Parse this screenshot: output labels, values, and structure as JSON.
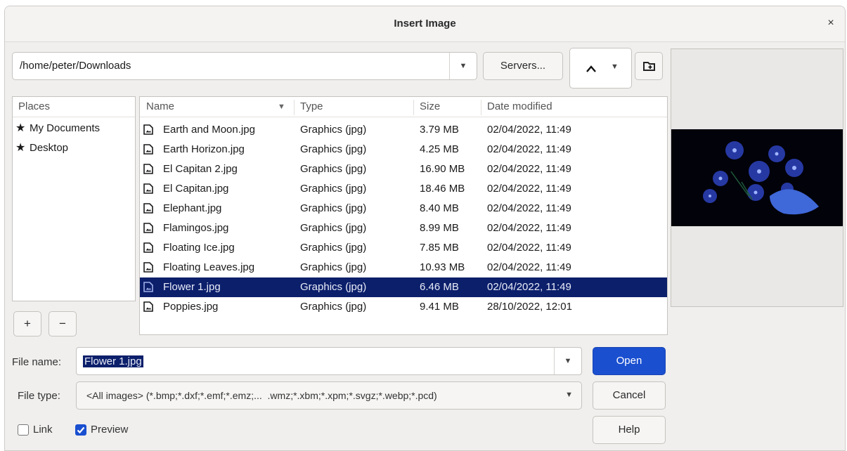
{
  "dialog": {
    "title": "Insert Image",
    "close_icon": "×"
  },
  "path": {
    "value": "/home/peter/Downloads",
    "dropdown_icon": "chevron-down-icon"
  },
  "toolbar": {
    "servers_label": "Servers...",
    "up_icon": "^",
    "up_dropdown_icon": "▾",
    "new_folder_icon": "new-folder-icon"
  },
  "places": {
    "header": "Places",
    "items": [
      {
        "label": "My Documents",
        "icon": "star-icon"
      },
      {
        "label": "Desktop",
        "icon": "star-icon"
      }
    ],
    "add_label": "+",
    "remove_label": "−"
  },
  "files": {
    "columns": {
      "name": "Name",
      "type": "Type",
      "size": "Size",
      "date": "Date modified"
    },
    "sort_icon": "▾",
    "rows": [
      {
        "name": "Earth and Moon.jpg",
        "type": "Graphics (jpg)",
        "size": "3.79 MB",
        "date": "02/04/2022, 11:49",
        "selected": false
      },
      {
        "name": "Earth Horizon.jpg",
        "type": "Graphics (jpg)",
        "size": "4.25 MB",
        "date": "02/04/2022, 11:49",
        "selected": false
      },
      {
        "name": "El Capitan 2.jpg",
        "type": "Graphics (jpg)",
        "size": "16.90 MB",
        "date": "02/04/2022, 11:49",
        "selected": false
      },
      {
        "name": "El Capitan.jpg",
        "type": "Graphics (jpg)",
        "size": "18.46 MB",
        "date": "02/04/2022, 11:49",
        "selected": false
      },
      {
        "name": "Elephant.jpg",
        "type": "Graphics (jpg)",
        "size": "8.40 MB",
        "date": "02/04/2022, 11:49",
        "selected": false
      },
      {
        "name": "Flamingos.jpg",
        "type": "Graphics (jpg)",
        "size": "8.99 MB",
        "date": "02/04/2022, 11:49",
        "selected": false
      },
      {
        "name": "Floating Ice.jpg",
        "type": "Graphics (jpg)",
        "size": "7.85 MB",
        "date": "02/04/2022, 11:49",
        "selected": false
      },
      {
        "name": "Floating Leaves.jpg",
        "type": "Graphics (jpg)",
        "size": "10.93 MB",
        "date": "02/04/2022, 11:49",
        "selected": false
      },
      {
        "name": "Flower 1.jpg",
        "type": "Graphics (jpg)",
        "size": "6.46 MB",
        "date": "02/04/2022, 11:49",
        "selected": true
      },
      {
        "name": "Poppies.jpg",
        "type": "Graphics (jpg)",
        "size": "9.41 MB",
        "date": "28/10/2022, 12:01",
        "selected": false
      }
    ]
  },
  "file_name": {
    "label": "File name:",
    "value": "Flower 1.jpg"
  },
  "file_type": {
    "label": "File type:",
    "value": "<All images> (*.bmp;*.dxf;*.emf;*.emz;...  .wmz;*.xbm;*.xpm;*.svgz;*.webp;*.pcd)"
  },
  "buttons": {
    "open": "Open",
    "cancel": "Cancel",
    "help": "Help"
  },
  "options": {
    "link_label": "Link",
    "link_checked": false,
    "preview_label": "Preview",
    "preview_checked": true
  },
  "colors": {
    "accent": "#1a4fd0",
    "selection": "#0c1f6b"
  }
}
